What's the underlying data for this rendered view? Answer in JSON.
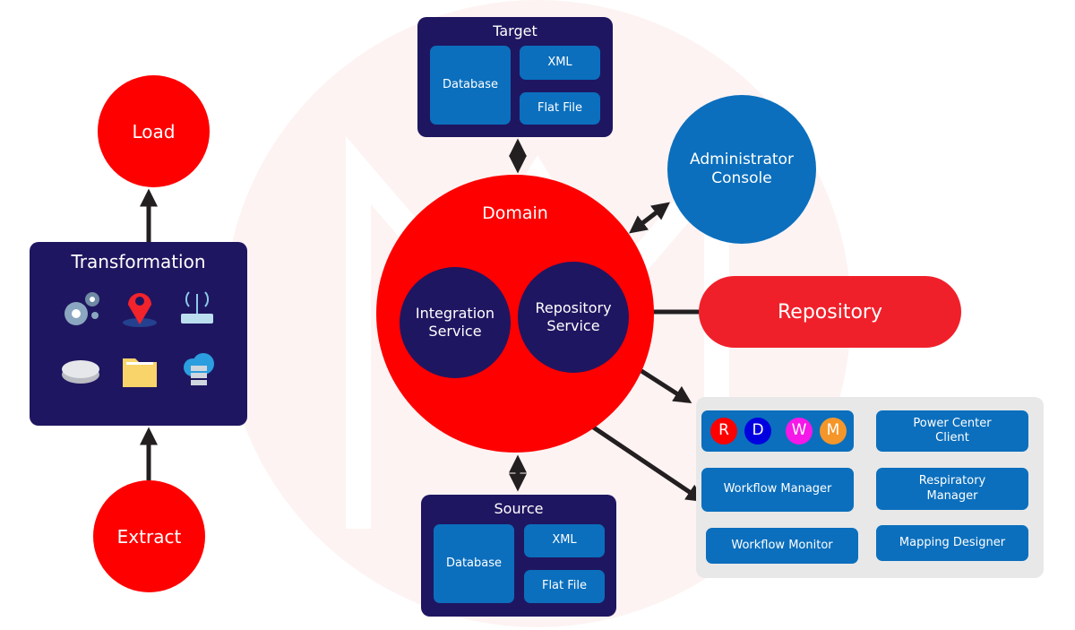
{
  "etl": {
    "load": "Load",
    "transformation": "Transformation",
    "extract": "Extract",
    "icons": [
      "gears-icon",
      "map-pin-icon",
      "wifi-router-icon",
      "disk-icon",
      "folder-icon",
      "cloud-server-icon"
    ]
  },
  "target": {
    "title": "Target",
    "database": "Database",
    "xml": "XML",
    "flat_file": "Flat File"
  },
  "source": {
    "title": "Source",
    "database": "Database",
    "xml": "XML",
    "flat_file": "Flat File"
  },
  "domain": {
    "title": "Domain",
    "integration_service": "Integration Service",
    "repository_service": "Repository Service"
  },
  "admin_console": "Administrator Console",
  "repository": "Repository",
  "client": {
    "badges": [
      {
        "letter": "R",
        "color": "#fe0000"
      },
      {
        "letter": "D",
        "color": "#0000e0"
      },
      {
        "letter": "W",
        "color": "#f518e8"
      },
      {
        "letter": "M",
        "color": "#f5962a"
      }
    ],
    "power_center": "Power Center Client",
    "workflow_manager": "Workflow Manager",
    "respiratory_manager": "Respiratory Manager",
    "workflow_monitor": "Workflow Monitor",
    "mapping_designer": "Mapping Designer"
  },
  "colors": {
    "red": "#fe0000",
    "navy": "#1f1661",
    "blue": "#0b6fbd",
    "panel": "#e8e8e8"
  }
}
